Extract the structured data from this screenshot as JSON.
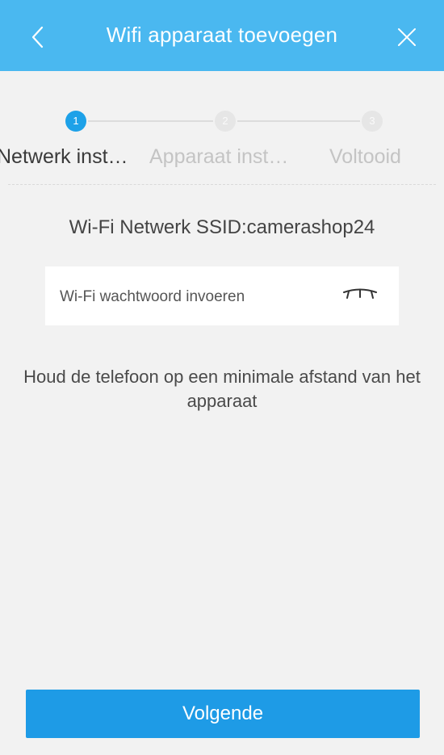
{
  "header": {
    "title": "Wifi apparaat toevoegen",
    "back_icon": "chevron-left-icon",
    "close_icon": "close-icon",
    "background": "#4ab8f0"
  },
  "stepper": {
    "steps": [
      {
        "number": "1",
        "label": "Netwerk inst…",
        "active": true
      },
      {
        "number": "2",
        "label": "Apparaat inst…",
        "active": false
      },
      {
        "number": "3",
        "label": "Voltooid",
        "active": false
      }
    ],
    "active_color": "#1da1e8"
  },
  "network": {
    "ssid_text": "Wi-Fi Netwerk SSID:camerashop24"
  },
  "password": {
    "placeholder": "Wi-Fi wachtwoord invoeren",
    "value": "",
    "toggle_icon": "eye-closed-icon"
  },
  "hint": {
    "text": "Houd de telefoon op een minimale afstand van het apparaat"
  },
  "footer": {
    "next_label": "Volgende",
    "button_color": "#1e9be6"
  }
}
